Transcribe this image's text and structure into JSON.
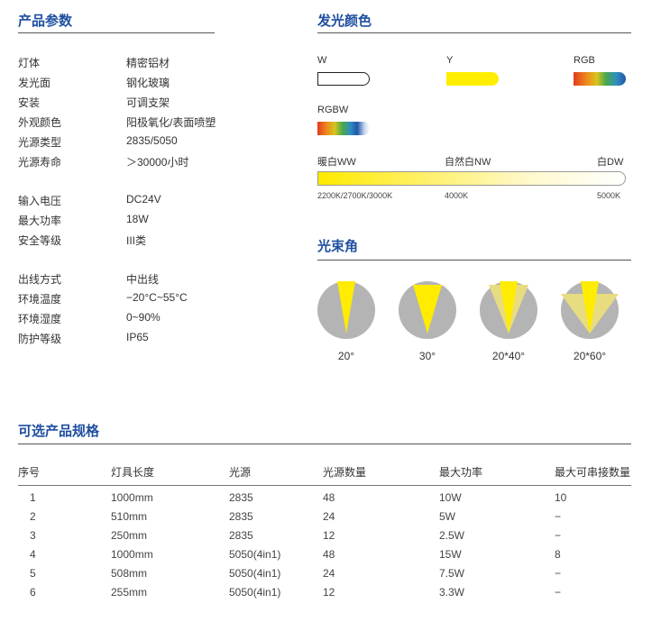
{
  "params": {
    "title": "产品参数",
    "groups": [
      [
        {
          "label": "灯体",
          "value": "精密铝材"
        },
        {
          "label": "发光面",
          "value": "钢化玻璃"
        },
        {
          "label": "安装",
          "value": "可调支架"
        },
        {
          "label": "外观颜色",
          "value": "阳极氧化/表面喷塑"
        },
        {
          "label": "光源类型",
          "value": "2835/5050"
        },
        {
          "label": "光源寿命",
          "value": "＞30000小时"
        }
      ],
      [
        {
          "label": "输入电压",
          "value": "DC24V"
        },
        {
          "label": "最大功率",
          "value": "18W"
        },
        {
          "label": "安全等级",
          "value": "III类"
        }
      ],
      [
        {
          "label": "出线方式",
          "value": "中出线"
        },
        {
          "label": "环境温度",
          "value": "−20°C~55°C"
        },
        {
          "label": "环境湿度",
          "value": "0~90%"
        },
        {
          "label": "防护等级",
          "value": "IP65"
        }
      ]
    ]
  },
  "colors": {
    "title": "发光颜色",
    "w": "W",
    "y": "Y",
    "rgb": "RGB",
    "rgbw": "RGBW",
    "ww": "暖白WW",
    "nw": "自然白NW",
    "dw": "白DW",
    "t1": "2200K/2700K/3000K",
    "t2": "4000K",
    "t3": "5000K",
    "accent": "#1f4fa0",
    "yellow": "#ffee00"
  },
  "beam": {
    "title": "光束角",
    "angles": [
      "20°",
      "30°",
      "20*40°",
      "20*60°"
    ]
  },
  "spec": {
    "title": "可选产品规格",
    "headers": [
      "序号",
      "灯具长度",
      "光源",
      "光源数量",
      "最大功率",
      "最大可串接数量"
    ],
    "rows": [
      [
        "1",
        "1000mm",
        "2835",
        "48",
        "10W",
        "10"
      ],
      [
        "2",
        "510mm",
        "2835",
        "24",
        "5W",
        "−"
      ],
      [
        "3",
        "250mm",
        "2835",
        "12",
        "2.5W",
        "−"
      ],
      [
        "4",
        "1000mm",
        "5050(4in1)",
        "48",
        "15W",
        "8"
      ],
      [
        "5",
        "508mm",
        "5050(4in1)",
        "24",
        "7.5W",
        "−"
      ],
      [
        "6",
        "255mm",
        "5050(4in1)",
        "12",
        "3.3W",
        "−"
      ]
    ]
  }
}
